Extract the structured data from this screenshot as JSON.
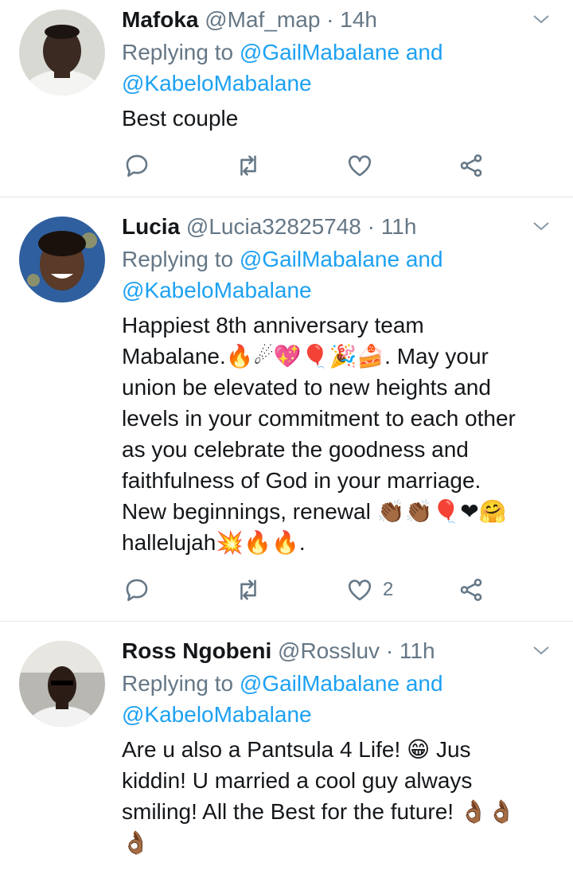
{
  "tweets": [
    {
      "name": "Mafoka",
      "handle": "@Maf_map",
      "separator": "·",
      "time": "14h",
      "replying_prefix": "Replying to",
      "replying_to_1": "@GailMabalane",
      "replying_and": "and",
      "replying_to_2": "@KabeloMabalane",
      "text": "Best couple",
      "like_count": ""
    },
    {
      "name": "Lucia",
      "handle": "@Lucia32825748",
      "separator": "·",
      "time": "11h",
      "replying_prefix": "Replying to",
      "replying_to_1": "@GailMabalane",
      "replying_and": "and",
      "replying_to_2": "@KabeloMabalane",
      "text_lines": [
        "Happiest 8th anniversary team",
        "Mabalane.🔥☄💖🎈🎉🍰. May your",
        "union be elevated to new heights and",
        "levels in your commitment to each other",
        "as you celebrate the goodness and",
        "faithfulness of God in your marriage.",
        "New beginnings, renewal 👏🏾👏🏾🎈❤🤗",
        "hallelujah💥🔥🔥."
      ],
      "like_count": "2"
    },
    {
      "name": "Ross Ngobeni",
      "handle": "@Rossluv",
      "separator": "·",
      "time": "11h",
      "replying_prefix": "Replying to",
      "replying_to_1": "@GailMabalane",
      "replying_and": "and",
      "replying_to_2": "@KabeloMabalane",
      "text_lines": [
        "Are u also a Pantsula 4 Life! 😁 Jus",
        "kiddin! U married a cool guy always",
        "smiling! All the Best for the future! 👌🏾👌🏾",
        "👌🏾"
      ]
    }
  ],
  "icons": {
    "reply": "reply-icon",
    "retweet": "retweet-icon",
    "like": "heart-icon",
    "share": "share-icon",
    "more": "chevron-down-icon"
  },
  "colors": {
    "name": "#14171a",
    "muted": "#657786",
    "mention": "#1da1f2",
    "divider": "#e1e8ed"
  }
}
